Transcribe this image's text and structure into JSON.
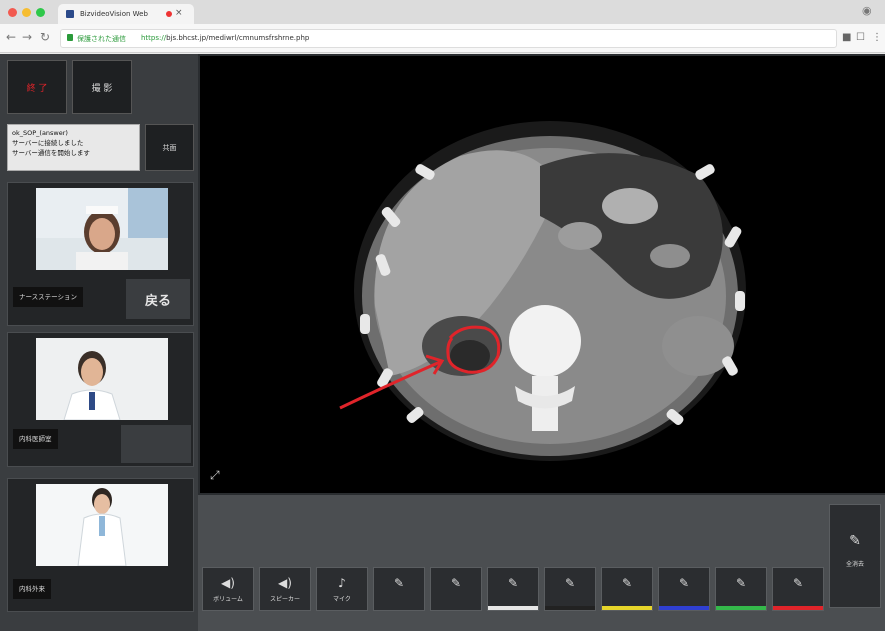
{
  "browser": {
    "tab_title": "BizvideoVision Web",
    "url_secure_label": "保護された通信",
    "url_scheme": "https://",
    "url_host": "bjs.bhcst.jp/mediwrl/cmnumsfrshrne.php"
  },
  "left_panel": {
    "button_top_left": "終 了",
    "button_top_right": "撮 影",
    "status_lines": [
      "ok_SOP_(answer)",
      "サーバーに接続しました",
      "サーバー通信を開始します"
    ],
    "status_side_button": "共面",
    "participants": [
      {
        "name": "ナースステーション",
        "back_label": "戻る"
      },
      {
        "name": "内科医師室"
      },
      {
        "name": "内科外来"
      }
    ]
  },
  "toolbar": {
    "tools": [
      {
        "label": "ボリューム",
        "icon": "speaker-icon"
      },
      {
        "label": "スピーカー",
        "icon": "speaker-icon"
      },
      {
        "label": "マイク",
        "icon": "microphone-icon"
      },
      {
        "label": "",
        "icon": "pen-icon"
      },
      {
        "label": "",
        "icon": "pen-icon"
      },
      {
        "label": "",
        "icon": "pen-icon",
        "color": "#e6e6e6"
      },
      {
        "label": "",
        "icon": "pen-icon",
        "color": "#222222"
      },
      {
        "label": "",
        "icon": "pen-icon",
        "color": "#e6d52a"
      },
      {
        "label": "",
        "icon": "pen-icon",
        "color": "#2f3fd1"
      },
      {
        "label": "",
        "icon": "pen-icon",
        "color": "#34b84a"
      },
      {
        "label": "",
        "icon": "pen-icon",
        "color": "#e0242a"
      }
    ],
    "eraser_label": "全消去"
  },
  "colors": {
    "accent_red": "#e0242a",
    "secure_green": "#2a9a3a"
  }
}
